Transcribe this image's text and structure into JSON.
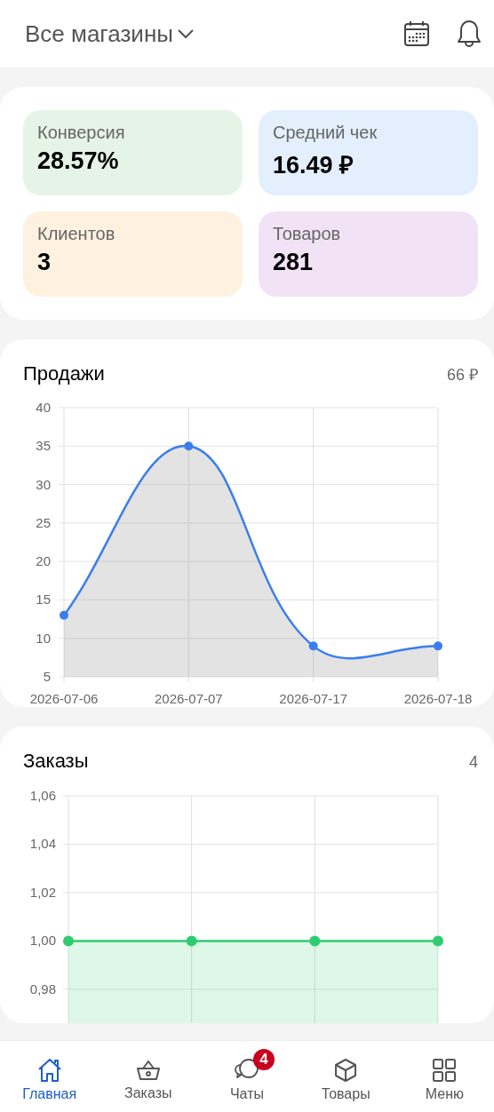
{
  "header": {
    "store_selector": "Все магазины"
  },
  "stats": [
    {
      "label": "Конверсия",
      "value": "28.57%",
      "color": "#e6f4e7"
    },
    {
      "label": "Средний чек",
      "value": "16.49 ₽",
      "color": "#e3effc"
    },
    {
      "label": "Клиентов",
      "value": "3",
      "color": "#fff1df"
    },
    {
      "label": "Товаров",
      "value": "281",
      "color": "#f1e3f5"
    }
  ],
  "sales": {
    "title": "Продажи",
    "total": "66 ₽",
    "chart_data": {
      "type": "area",
      "categories": [
        "2026-07-06",
        "2026-07-07",
        "2026-07-17",
        "2026-07-18"
      ],
      "series": [
        {
          "color": "#3b7ded",
          "values": [
            13,
            35,
            9,
            9
          ]
        }
      ],
      "grid": true,
      "ylim": [
        5,
        40
      ],
      "yticks": [
        5,
        10,
        15,
        20,
        25,
        30,
        35,
        40
      ]
    }
  },
  "orders": {
    "title": "Заказы",
    "total": "4",
    "chart_data": {
      "type": "area",
      "series": [
        {
          "color": "#2ecc71",
          "values": [
            1,
            1,
            1,
            1
          ]
        }
      ],
      "grid": true,
      "ylim": [
        0.966,
        1.06
      ],
      "yticks": [
        {
          "value": 0.98,
          "label": "0,98"
        },
        {
          "value": 1.0,
          "label": "1,00"
        },
        {
          "value": 1.02,
          "label": "1,02"
        },
        {
          "value": 1.04,
          "label": "1,04"
        },
        {
          "value": 1.06,
          "label": "1,06"
        }
      ]
    }
  },
  "nav": [
    {
      "kind": "home",
      "label": "Главная",
      "selected": true
    },
    {
      "kind": "basket",
      "label": "Заказы",
      "selected": false
    },
    {
      "kind": "chat",
      "label": "Чаты",
      "selected": false,
      "badge": "4"
    },
    {
      "kind": "box",
      "label": "Товары",
      "selected": false
    },
    {
      "kind": "grid",
      "label": "Меню",
      "selected": false
    }
  ]
}
